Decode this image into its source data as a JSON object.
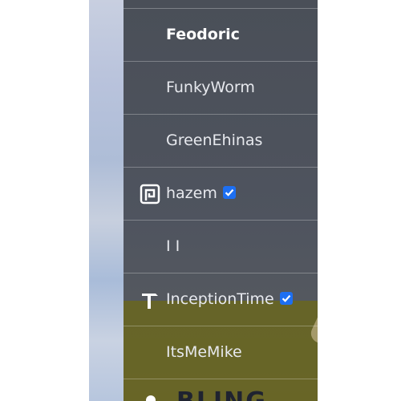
{
  "users": [
    {
      "name": "Feodoric",
      "bold": true,
      "icon": "",
      "verified": false
    },
    {
      "name": "FunkyWorm",
      "bold": false,
      "icon": "",
      "verified": false
    },
    {
      "name": "GreenEhinas",
      "bold": false,
      "icon": "",
      "verified": false
    },
    {
      "name": "hazem",
      "bold": false,
      "icon": "square-spiral-logo-icon",
      "verified": true
    },
    {
      "name": "I I",
      "bold": false,
      "icon": "",
      "verified": false
    },
    {
      "name": "InceptionTime",
      "bold": false,
      "icon": "hammer-icon",
      "verified": true
    },
    {
      "name": "ItsMeMike",
      "bold": false,
      "icon": "",
      "verified": false
    }
  ],
  "partial_entry": {
    "name": "BLING",
    "icon": "circle-icon"
  },
  "colors": {
    "verified_badge": "#1d6ff2",
    "panel": "#4d525c",
    "overlay": "#6e6914"
  }
}
